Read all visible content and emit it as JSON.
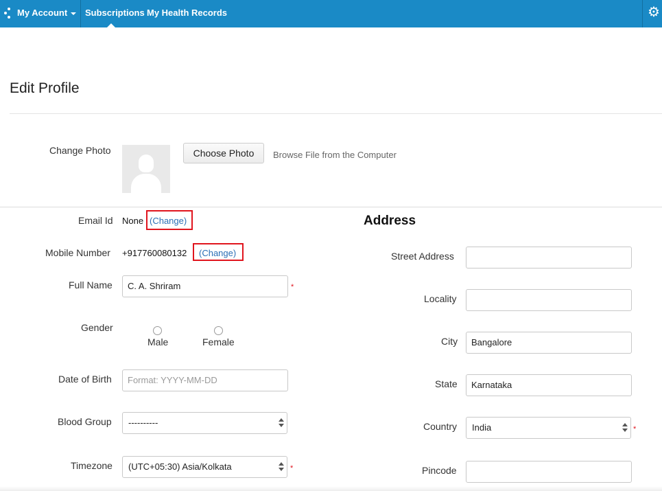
{
  "nav": {
    "account_label": "My Account",
    "subscriptions_label": "Subscriptions",
    "health_records_label": "My Health Records",
    "settings_icon": "gear-icon",
    "brand_color": "#1a8ac6"
  },
  "page": {
    "title": "Edit Profile"
  },
  "photo": {
    "label": "Change Photo",
    "button_label": "Choose Photo",
    "hint": "Browse File from the Computer",
    "avatar_icon": "avatar-placeholder-icon"
  },
  "profile": {
    "email_label": "Email Id",
    "email_value": "None",
    "email_change": "(Change)",
    "mobile_label": "Mobile Number",
    "mobile_value": "+917760080132",
    "mobile_change": "(Change)",
    "fullname_label": "Full Name",
    "fullname_value": "C. A. Shriram",
    "gender_label": "Gender",
    "gender_options": [
      "Male",
      "Female"
    ],
    "dob_label": "Date of Birth",
    "dob_placeholder": "Format: YYYY-MM-DD",
    "blood_label": "Blood Group",
    "blood_value": "----------",
    "timezone_label": "Timezone",
    "timezone_value": "(UTC+05:30) Asia/Kolkata",
    "required_mark": "*"
  },
  "address": {
    "title": "Address",
    "street_label": "Street Address",
    "street_value": "",
    "locality_label": "Locality",
    "locality_value": "",
    "city_label": "City",
    "city_value": "Bangalore",
    "state_label": "State",
    "state_value": "Karnataka",
    "country_label": "Country",
    "country_value": "India",
    "pincode_label": "Pincode",
    "pincode_value": ""
  },
  "colors": {
    "highlight": "#e0141d",
    "link": "#2a6fb6"
  }
}
